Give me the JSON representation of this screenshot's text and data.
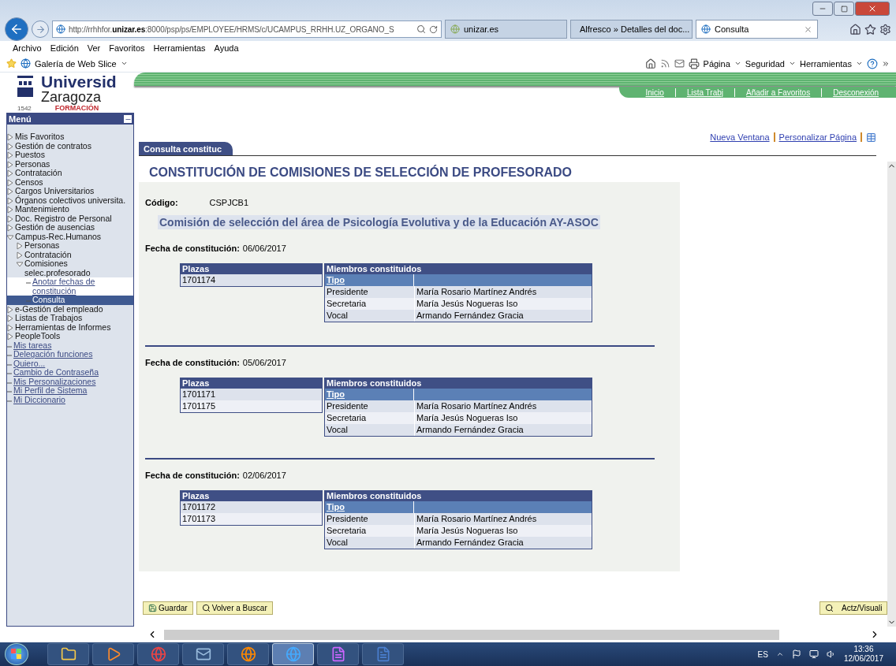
{
  "browser": {
    "url_host": "http://rrhhfor.",
    "url_bold": "unizar.es",
    "url_rest": ":8000/psp/ps/EMPLOYEE/HRMS/c/UCAMPUS_RRHH.UZ_ORGANO_S",
    "tabs": [
      {
        "label": "unizar.es",
        "selected": false,
        "closable": false
      },
      {
        "label": "Alfresco » Detalles del doc...",
        "selected": false,
        "closable": false
      },
      {
        "label": "Consulta",
        "selected": true,
        "closable": true
      }
    ],
    "menu": [
      "Archivo",
      "Edición",
      "Ver",
      "Favoritos",
      "Herramientas",
      "Ayuda"
    ],
    "favorites": "Galería de Web Slice",
    "commands": [
      "Página",
      "Seguridad",
      "Herramientas"
    ]
  },
  "header": {
    "brand": "Universid",
    "city": "Zaragoza",
    "year": "1542",
    "subtitle": "FORMACIÓN",
    "links": [
      "Inicio",
      "Lista Trabj",
      "Añadir a Favoritos",
      "Desconexión"
    ]
  },
  "sidebar": {
    "title": "Menú",
    "items": [
      {
        "label": "Mis Favoritos",
        "kind": "folder",
        "expanded": false,
        "selected": false
      },
      {
        "label": "Gestión de contratos",
        "kind": "folder",
        "expanded": false,
        "selected": false
      },
      {
        "label": "Puestos",
        "kind": "folder",
        "expanded": false,
        "selected": false
      },
      {
        "label": "Personas",
        "kind": "folder",
        "expanded": false,
        "selected": false
      },
      {
        "label": "Contratación",
        "kind": "folder",
        "expanded": false,
        "selected": false
      },
      {
        "label": "Censos",
        "kind": "folder",
        "expanded": false,
        "selected": false
      },
      {
        "label": "Cargos Universitarios",
        "kind": "folder",
        "expanded": false,
        "selected": false
      },
      {
        "label": "Órganos colectivos universita.",
        "kind": "folder",
        "expanded": false,
        "selected": false
      },
      {
        "label": "Mantenimiento",
        "kind": "folder",
        "expanded": false,
        "selected": false
      },
      {
        "label": "Doc. Registro de Personal",
        "kind": "folder",
        "expanded": false,
        "selected": false
      },
      {
        "label": "Gestión de ausencias",
        "kind": "folder",
        "expanded": false,
        "selected": false
      },
      {
        "label": "Campus-Rec.Humanos",
        "kind": "folder",
        "expanded": true,
        "selected": false,
        "children": [
          {
            "label": "Personas",
            "kind": "folder",
            "expanded": false,
            "selected": false
          },
          {
            "label": "Contratación",
            "kind": "folder",
            "expanded": false,
            "selected": false
          },
          {
            "label": "Comisiones selec.profesorado",
            "kind": "folder",
            "expanded": true,
            "selected": false,
            "children": [
              {
                "label": "Anotar fechas de constitución",
                "kind": "link",
                "selected": false
              },
              {
                "label": "Consulta",
                "kind": "link",
                "selected": true
              }
            ]
          }
        ]
      },
      {
        "label": "e-Gestión del empleado",
        "kind": "folder",
        "expanded": false,
        "selected": false
      },
      {
        "label": "Listas de Trabajos",
        "kind": "folder",
        "expanded": false,
        "selected": false
      },
      {
        "label": "Herramientas de Informes",
        "kind": "folder",
        "expanded": false,
        "selected": false
      },
      {
        "label": "PeopleTools",
        "kind": "folder",
        "expanded": false,
        "selected": false
      },
      {
        "label": "Mis tareas",
        "kind": "link",
        "selected": false
      },
      {
        "label": "Delegación funciones",
        "kind": "link",
        "selected": false
      },
      {
        "label": "Quiero...",
        "kind": "link",
        "selected": false
      },
      {
        "label": "Cambio de Contraseña",
        "kind": "link",
        "selected": false
      },
      {
        "label": "Mis Personalizaciones",
        "kind": "link",
        "selected": false
      },
      {
        "label": "Mi Perfil de Sistema",
        "kind": "link",
        "selected": false
      },
      {
        "label": "Mi Diccionario",
        "kind": "link",
        "selected": false
      }
    ]
  },
  "page": {
    "links": [
      "Nueva Ventana",
      "Personalizar Página"
    ],
    "tabs": [
      {
        "label": "Consulta constituc",
        "selected": true
      }
    ],
    "title": "CONSTITUCIÓN DE COMISIONES DE SELECCIÓN DE PROFESORADO",
    "code_label": "Código:",
    "code": "CSPJCB1",
    "committee": "Comisión de selección del área de Psicología Evolutiva y de la Educación AY-ASOC",
    "sections": [
      {
        "date_label": "Fecha de constitución:",
        "date": "06/06/2017",
        "plazas_header": "Plazas",
        "plazas": [
          "1701174"
        ],
        "members_header": "Miembros constituidos",
        "type_header": "Tipo",
        "members": [
          {
            "role": "Presidente",
            "name": "María Rosario Martínez Andrés"
          },
          {
            "role": "Secretaria",
            "name": "María Jesús Nogueras Iso"
          },
          {
            "role": "Vocal",
            "name": "Armando Fernández Gracia"
          }
        ]
      },
      {
        "date_label": "Fecha de constitución:",
        "date": "05/06/2017",
        "plazas_header": "Plazas",
        "plazas": [
          "1701171",
          "1701175"
        ],
        "members_header": "Miembros constituidos",
        "type_header": "Tipo",
        "members": [
          {
            "role": "Presidente",
            "name": "María Rosario Martínez Andrés"
          },
          {
            "role": "Secretaria",
            "name": "María Jesús Nogueras Iso"
          },
          {
            "role": "Vocal",
            "name": "Armando Fernández Gracia"
          }
        ]
      },
      {
        "date_label": "Fecha de constitución:",
        "date": "02/06/2017",
        "plazas_header": "Plazas",
        "plazas": [
          "1701172",
          "1701173"
        ],
        "members_header": "Miembros constituidos",
        "type_header": "Tipo",
        "members": [
          {
            "role": "Presidente",
            "name": "María Rosario Martínez Andrés"
          },
          {
            "role": "Secretaria",
            "name": "María Jesús Nogueras Iso"
          },
          {
            "role": "Vocal",
            "name": "Armando Fernández Gracia"
          }
        ]
      }
    ],
    "buttons": [
      {
        "label": "Guardar",
        "kind": "save"
      },
      {
        "label": "Volver a Buscar",
        "kind": "search"
      }
    ],
    "right_button": "Actz/Visuali"
  },
  "taskbar": {
    "apps": [
      {
        "kind": "folder",
        "active": false
      },
      {
        "kind": "media",
        "active": false
      },
      {
        "kind": "globe",
        "active": false
      },
      {
        "kind": "mail",
        "active": false
      },
      {
        "kind": "fox",
        "active": false
      },
      {
        "kind": "ie",
        "active": true
      },
      {
        "kind": "pdf",
        "active": false
      },
      {
        "kind": "word",
        "active": false
      }
    ],
    "lang": "ES",
    "time": "13:36",
    "date": "12/06/2017"
  }
}
